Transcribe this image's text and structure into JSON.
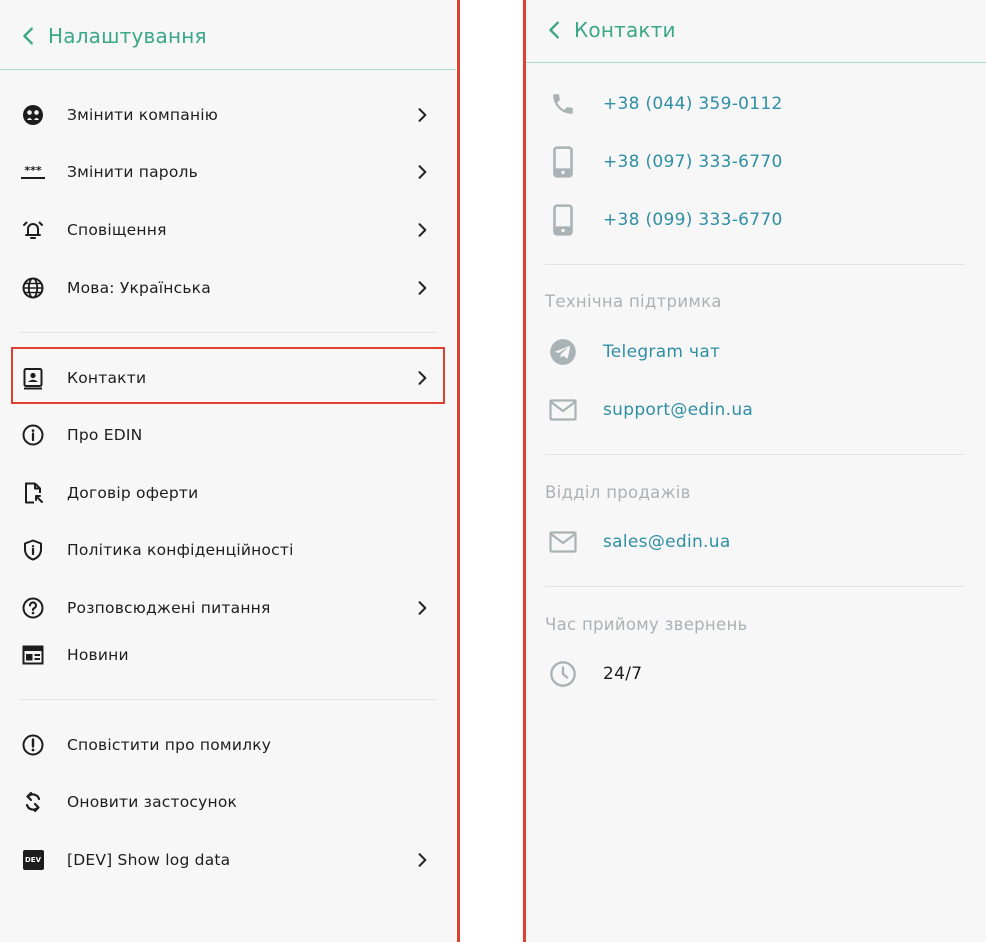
{
  "settings": {
    "title": "Налаштування",
    "items": [
      {
        "label": "Змінити компанію"
      },
      {
        "label": "Змінити пароль"
      },
      {
        "label": "Сповіщення"
      },
      {
        "label": "Мова: Українська"
      },
      {
        "label": "Контакти"
      },
      {
        "label": "Про EDIN"
      },
      {
        "label": "Договір оферти"
      },
      {
        "label": "Політика конфіденційності"
      },
      {
        "label": "Розповсюджені питання"
      },
      {
        "label": "Новини"
      },
      {
        "label": "Сповістити про помилку"
      },
      {
        "label": "Оновити застосунок"
      },
      {
        "label": "[DEV] Show log data"
      }
    ],
    "dev_badge": "DEV",
    "password_icon": "***"
  },
  "contacts": {
    "title": "Контакти",
    "phones": [
      "+38 (044) 359-0112",
      "+38 (097) 333-6770",
      "+38 (099) 333-6770"
    ],
    "support": {
      "heading": "Технічна підтримка",
      "telegram": "Telegram чат",
      "email": "support@edin.ua"
    },
    "sales": {
      "heading": "Відділ продажів",
      "email": "sales@edin.ua"
    },
    "hours": {
      "heading": "Час прийому звернень",
      "value": "24/7"
    }
  },
  "colors": {
    "accent_green": "#3aa785",
    "link_blue": "#2f8ea4",
    "highlight_red": "#e0402f",
    "muted_gray": "#a9b2b6"
  }
}
